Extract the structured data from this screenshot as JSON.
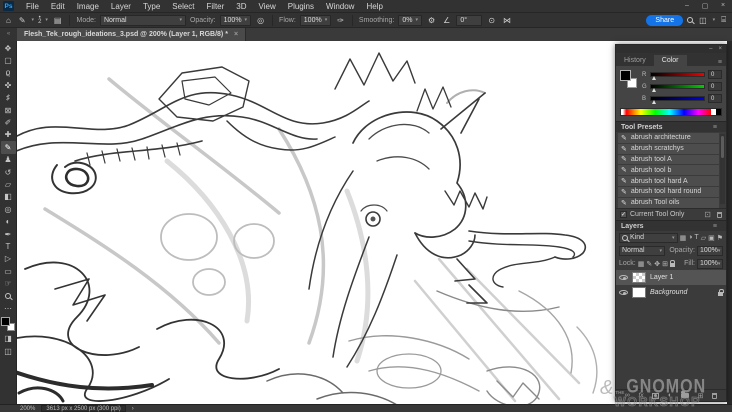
{
  "window": {
    "minimize": "–",
    "restore": "▢",
    "close": "×"
  },
  "menu": {
    "app_icon": "Ps",
    "items": [
      "File",
      "Edit",
      "Image",
      "Layer",
      "Type",
      "Select",
      "Filter",
      "3D",
      "View",
      "Plugins",
      "Window",
      "Help"
    ]
  },
  "options": {
    "home_icon": "⌂",
    "brush_icon": "✎",
    "chevron": "▾",
    "brush_dot": "•",
    "brush_size": "2",
    "brush_panel_icon": "▤",
    "mode_label": "Mode:",
    "mode_value": "Normal",
    "opacity_label": "Opacity:",
    "opacity_value": "100%",
    "opacity_pressure_icon": "◎",
    "flow_label": "Flow:",
    "flow_value": "100%",
    "airbrush_icon": "✑",
    "smoothing_label": "Smoothing:",
    "smoothing_value": "0%",
    "gear_icon": "⚙",
    "angle_icon": "∠",
    "angle_value": "0°",
    "size_pressure_icon": "⊙",
    "symmetry_icon": "⋈",
    "share_label": "Share",
    "workspace_icon": "◫",
    "export_icon": "⌸"
  },
  "tab": {
    "collapse_icon": "«",
    "title": "Flesh_Tek_rough_ideations_3.psd @ 200% (Layer 1, RGB/8) *",
    "close": "×"
  },
  "toolbar": {
    "tools": [
      {
        "name": "move",
        "glyph": "✥"
      },
      {
        "name": "marquee",
        "glyph": "▢"
      },
      {
        "name": "lasso",
        "glyph": "ϱ"
      },
      {
        "name": "quick-select",
        "glyph": "✜"
      },
      {
        "name": "crop",
        "glyph": "♯"
      },
      {
        "name": "frame",
        "glyph": "⊠"
      },
      {
        "name": "eyedropper",
        "glyph": "✐"
      },
      {
        "name": "healing-brush",
        "glyph": "✚"
      },
      {
        "name": "brush",
        "glyph": "✎"
      },
      {
        "name": "clone-stamp",
        "glyph": "♟"
      },
      {
        "name": "history-brush",
        "glyph": "↺"
      },
      {
        "name": "eraser",
        "glyph": "▱"
      },
      {
        "name": "gradient",
        "glyph": "◧"
      },
      {
        "name": "blur",
        "glyph": "◎"
      },
      {
        "name": "dodge",
        "glyph": "◐"
      },
      {
        "name": "pen",
        "glyph": "✒"
      },
      {
        "name": "type",
        "glyph": "T"
      },
      {
        "name": "path-select",
        "glyph": "▷"
      },
      {
        "name": "shape",
        "glyph": "▭"
      },
      {
        "name": "hand",
        "glyph": "☞"
      },
      {
        "name": "ellipsis",
        "glyph": "⋯"
      },
      {
        "name": "quick-mask",
        "glyph": "◨"
      },
      {
        "name": "screen-mode",
        "glyph": "◫"
      }
    ]
  },
  "panels": {
    "group": {
      "minimize": "–",
      "close": "×",
      "menu_icon": "≡"
    },
    "color": {
      "tab_history": "History",
      "tab_color": "Color",
      "channels": [
        {
          "label": "R",
          "value": "0"
        },
        {
          "label": "G",
          "value": "0"
        },
        {
          "label": "B",
          "value": "0"
        }
      ]
    },
    "presets": {
      "title": "Tool Presets",
      "items": [
        "abrush architecture",
        "abrush scratchys",
        "abrush tool A",
        "abrush tool b",
        "abrush tool hard A",
        "abrush tool hard round",
        "abrush Tool oils"
      ],
      "brush_icon": "✎",
      "checkbox_glyph": "✓",
      "checkbox_label": "Current Tool Only",
      "new_icon": "⊡"
    },
    "layers": {
      "title": "Layers",
      "kind_value": "Kind",
      "chevron": "▾",
      "filter_icons": [
        "▦",
        "◑",
        "T",
        "▱",
        "▣",
        "⚑"
      ],
      "blend_value": "Normal",
      "opacity_label": "Opacity:",
      "opacity_value": "100%",
      "lock_label": "Lock:",
      "lock_icons": [
        "▦",
        "✎",
        "✥",
        "⊞"
      ],
      "fill_label": "Fill:",
      "fill_value": "100%",
      "rows": [
        {
          "name": "Layer 1"
        },
        {
          "name": "Background"
        }
      ],
      "fx_label": "fx",
      "link_icon": "∞",
      "adjust_icon": "◐",
      "new_icon": "⊞"
    }
  },
  "status": {
    "zoom_level": "200%",
    "doc_info": "3613 px x 2500 px (300 ppi)",
    "arrow": "›"
  },
  "watermark": {
    "amp": "&",
    "the": "THE",
    "name": "GNOMON",
    "sub": "WORKSHOP"
  },
  "colors": {
    "accent_blue": "#1473e6",
    "foreground_swatch": "#000000",
    "background_swatch": "#ffffff"
  }
}
